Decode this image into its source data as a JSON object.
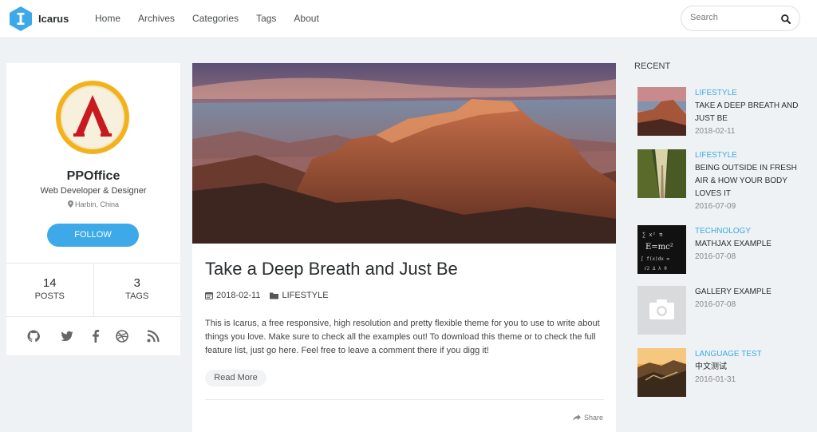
{
  "header": {
    "site_name": "Icarus",
    "nav": [
      "Home",
      "Archives",
      "Categories",
      "Tags",
      "About"
    ],
    "search_placeholder": "Search"
  },
  "profile": {
    "name": "PPOffice",
    "title": "Web Developer & Designer",
    "location": "Harbin, China",
    "follow_label": "FOLLOW",
    "posts_count": "14",
    "posts_label": "POSTS",
    "tags_count": "3",
    "tags_label": "TAGS",
    "socials": [
      "github-icon",
      "twitter-icon",
      "facebook-icon",
      "dribbble-icon",
      "rss-icon"
    ]
  },
  "article": {
    "title": "Take a Deep Breath and Just Be",
    "date": "2018-02-11",
    "category": "LIFESTYLE",
    "excerpt": "This is Icarus, a free responsive, high resolution and pretty flexible theme for you to use to write about things you love. Make sure to check all the examples out! To download this theme or to check the full feature list, just go here. Feel free to leave a comment there if you digg it!",
    "read_more": "Read More",
    "share": "Share"
  },
  "recent": {
    "heading": "RECENT",
    "items": [
      {
        "category": "LIFESTYLE",
        "title": "TAKE A DEEP BREATH AND JUST BE",
        "date": "2018-02-11"
      },
      {
        "category": "LIFESTYLE",
        "title": "BEING OUTSIDE IN FRESH AIR & HOW YOUR BODY LOVES IT",
        "date": "2016-07-09"
      },
      {
        "category": "TECHNOLOGY",
        "title": "MATHJAX EXAMPLE",
        "date": "2016-07-08"
      },
      {
        "category": "",
        "title": "GALLERY EXAMPLE",
        "date": "2016-07-08"
      },
      {
        "category": "LANGUAGE TEST",
        "title": "中文测试",
        "date": "2016-01-31"
      }
    ]
  },
  "colors": {
    "accent": "#3ea9e8",
    "background": "#eef2f4",
    "logo": "#3ea9e8"
  }
}
